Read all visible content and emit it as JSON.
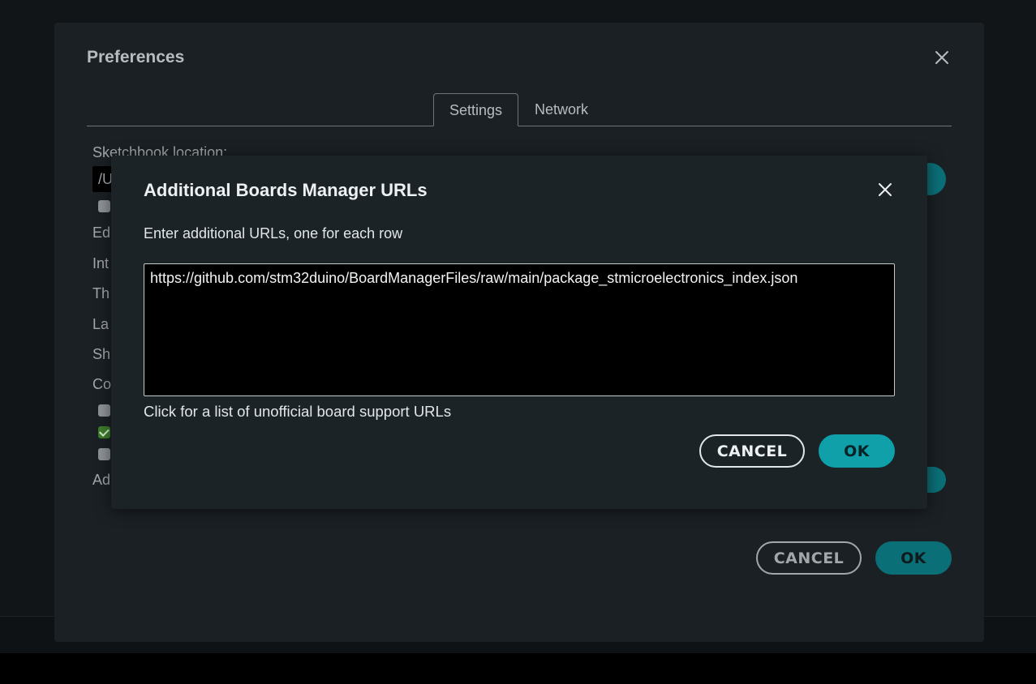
{
  "preferences": {
    "title": "Preferences",
    "tabs": [
      {
        "label": "Settings",
        "active": true
      },
      {
        "label": "Network",
        "active": false
      }
    ],
    "partial_labels": {
      "sketchbook": "Sketchbook location:",
      "path_fragment": "/U",
      "editor": "Ed",
      "interface": "Int",
      "theme": "Th",
      "language": "La",
      "show": "Sh",
      "compiler": "Co",
      "additional": "Ad"
    },
    "checkboxes": [
      {
        "checked": false
      },
      {
        "checked": false
      },
      {
        "checked": true
      },
      {
        "checked": false
      }
    ],
    "cancel_label": "CANCEL",
    "ok_label": "OK"
  },
  "modal": {
    "title": "Additional Boards Manager URLs",
    "description": "Enter additional URLs, one for each row",
    "urls_value": "https://github.com/stm32duino/BoardManagerFiles/raw/main/package_stmicroelectronics_index.json",
    "link_text": "Click for a list of unofficial board support URLs",
    "cancel_label": "CANCEL",
    "ok_label": "OK"
  },
  "colors": {
    "accent": "#0fa0aa",
    "accent_dim": "#0b6f77",
    "checkbox_checked": "#3d7d2b"
  },
  "icons": {
    "close": "close-icon",
    "check": "checkmark"
  }
}
